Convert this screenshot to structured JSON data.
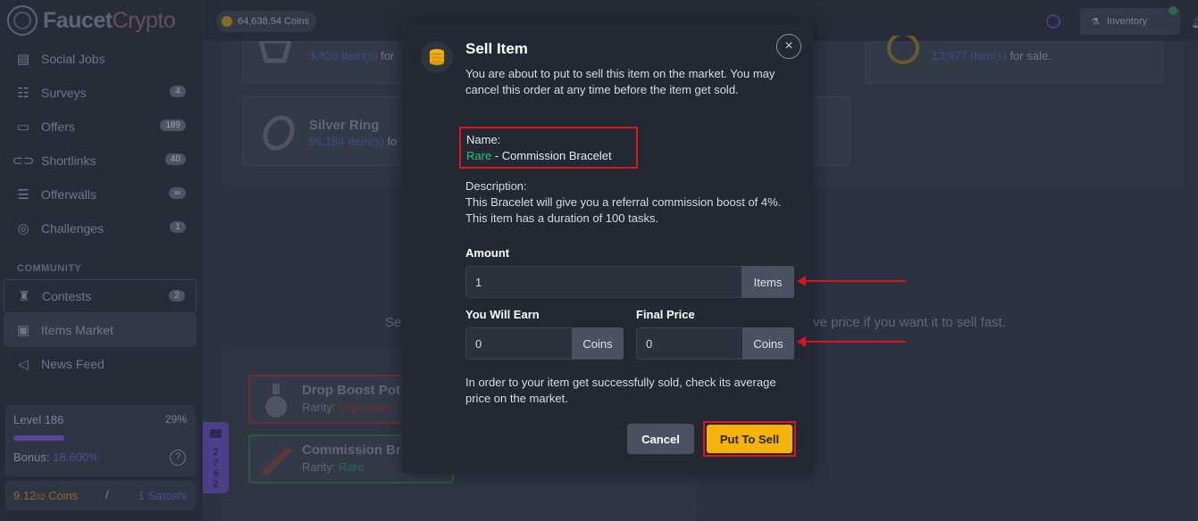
{
  "brand": {
    "name_part1": "Faucet",
    "name_part2": "Crypto"
  },
  "topbar": {
    "coins": "64,638.54 Coins",
    "inventory_label": "Inventory"
  },
  "sidebar": {
    "items": [
      {
        "label": "Social Jobs",
        "badge": ""
      },
      {
        "label": "Surveys",
        "badge": "4"
      },
      {
        "label": "Offers",
        "badge": "189"
      },
      {
        "label": "Shortlinks",
        "badge": "40"
      },
      {
        "label": "Offerwalls",
        "badge": "∞"
      },
      {
        "label": "Challenges",
        "badge": "1"
      }
    ],
    "community_heading": "COMMUNITY",
    "community_items": [
      {
        "label": "Contests",
        "badge": "2"
      },
      {
        "label": "Items Market",
        "badge": ""
      },
      {
        "label": "News Feed",
        "badge": ""
      }
    ],
    "level": {
      "title": "Level 186",
      "percent": "29%",
      "progress": 0.29,
      "bonus_label": "Bonus:",
      "bonus_value": "18.600%",
      "help": "?"
    },
    "balance": {
      "coins_main": "9.12",
      "coins_small": "02",
      "coins_unit": " Coins",
      "separator": "/",
      "satoshi": "1 Satoshi"
    }
  },
  "background": {
    "card1_sub_count": "3,826 Item(s)",
    "card1_sub_rest": " for",
    "card2_sub_count": "13,977 Item(s)",
    "card2_sub_rest": " for sale.",
    "card3_title": "Silver Ring",
    "card3_sub_count": "96,184 Item(s)",
    "card3_sub_rest": " fo",
    "sell_text_left": "Se",
    "sell_text_right": "ve price if you want it to sell fast.",
    "item1_title": "Drop Boost Pot",
    "item1_rarity_label": "Rarity: ",
    "item1_rarity": "Legendary",
    "item2_title": "Commission Br",
    "item2_rarity_label": "Rarity: ",
    "item2_rarity": "Rare",
    "chat_count": "2762"
  },
  "modal": {
    "title": "Sell Item",
    "intro": "You are about to put to sell this item on the market. You may cancel this order at any time before the item get sold.",
    "name_label": "Name:",
    "name_rarity": "Rare",
    "name_value": " - Commission Bracelet",
    "description_label": "Description:",
    "description_text": "This Bracelet will give you a referral commission boost of 4%. This item has a duration of 100 tasks.",
    "amount_label": "Amount",
    "amount_value": "1",
    "amount_unit": "Items",
    "earn_label": "You Will Earn",
    "earn_value": "0",
    "earn_unit": "Coins",
    "final_label": "Final Price",
    "final_value": "0",
    "final_unit": "Coins",
    "note": "In order to your item get successfully sold, check its average price on the market.",
    "cancel_label": "Cancel",
    "sell_label": "Put To Sell"
  },
  "colors": {
    "accent": "#f5b20a",
    "rare": "#26c281",
    "highlight": "#e0131f"
  }
}
